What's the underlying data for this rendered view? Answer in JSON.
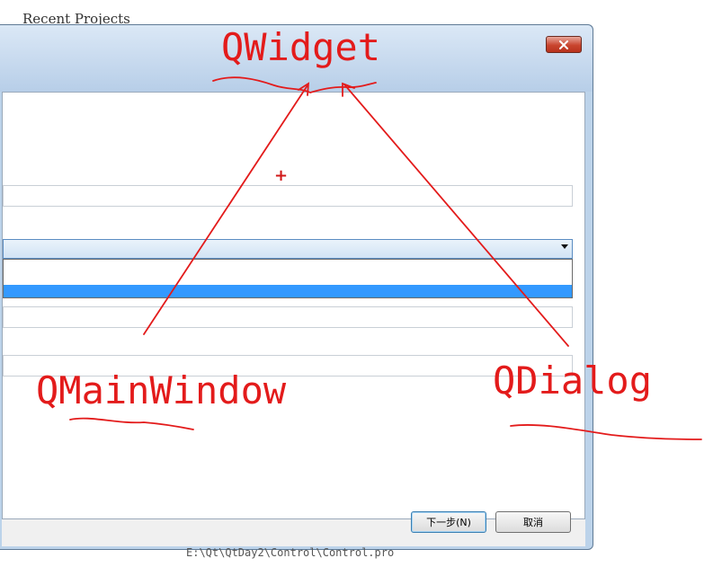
{
  "background": {
    "heading": "Recent Projects",
    "project_path": "E:\\Qt\\QtDay2\\Control\\Control.pro"
  },
  "dialog": {
    "close_icon": "close-icon",
    "buttons": {
      "next": "下一步(N)",
      "cancel": "取消"
    }
  },
  "annotations": {
    "qwidget": "QWidget",
    "qmainwindow": "QMainWindow",
    "qdialog": "QDialog",
    "cursor": "+"
  },
  "colors": {
    "annotation": "#e31b1b",
    "selection": "#3399ff",
    "close_button": "#c9452f"
  }
}
